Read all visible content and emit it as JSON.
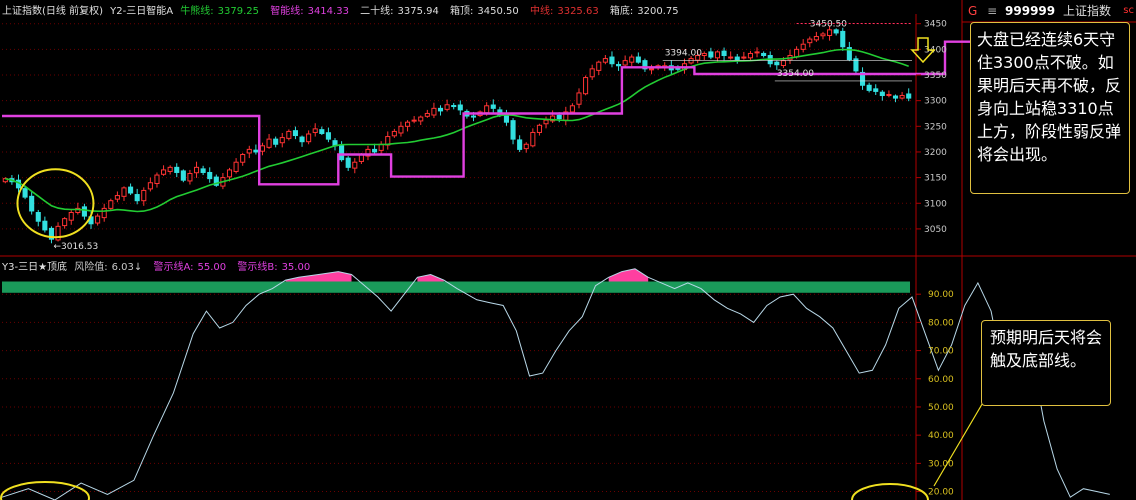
{
  "header_top": {
    "name": "上证指数(日线 前复权)",
    "indicator": "Y2-三日智能A",
    "items": [
      {
        "label": "牛熊线:",
        "value": "3379.25",
        "color": "#22cc33"
      },
      {
        "label": "智能线:",
        "value": "3414.33",
        "color": "#e040e0"
      },
      {
        "label": "二十线:",
        "value": "3375.94",
        "color": "#dddddd"
      },
      {
        "label": "箱顶:",
        "value": "3450.50",
        "color": "#dddddd"
      },
      {
        "label": "中线:",
        "value": "3325.63",
        "color": "#e03030"
      },
      {
        "label": "箱底:",
        "value": "3200.75",
        "color": "#dddddd"
      }
    ]
  },
  "header_bottom": {
    "name": "Y3-三日★顶底",
    "items": [
      {
        "label": "风险值:",
        "value": "6.03↓",
        "color": "#c8c8c8"
      },
      {
        "label": "警示线A:",
        "value": "55.00",
        "color": "#e040e0"
      },
      {
        "label": "警示线B:",
        "value": "35.00",
        "color": "#e040e0"
      }
    ]
  },
  "side": {
    "code_prefix": "G",
    "code": "999999",
    "name": "上证指数",
    "corner": "sc"
  },
  "callouts": {
    "top": "大盘已经连续6天守住3300点不破。如果明后天再不破，反身向上站稳3310点上方，阶段性弱反弹将会出现。",
    "bottom": "预期明后天将会触及底部线。"
  },
  "chart_data": [
    {
      "type": "candlestick",
      "title": "",
      "y_ticks": [
        "3450",
        "3400",
        "3350",
        "3300",
        "3250",
        "3200",
        "3150",
        "3100",
        "3050"
      ],
      "ylim": [
        3005,
        3465
      ],
      "annotations": {
        "low_label": "←3016.53",
        "box_top": "3450.50",
        "level_3394": "3394.00",
        "level_3354": "3354.00"
      },
      "closes": [
        3148,
        3142,
        3130,
        3112,
        3085,
        3065,
        3048,
        3030,
        3055,
        3070,
        3082,
        3090,
        3075,
        3060,
        3075,
        3090,
        3105,
        3115,
        3130,
        3120,
        3105,
        3125,
        3140,
        3155,
        3165,
        3170,
        3160,
        3145,
        3158,
        3170,
        3160,
        3148,
        3135,
        3150,
        3165,
        3180,
        3195,
        3205,
        3200,
        3212,
        3225,
        3215,
        3228,
        3240,
        3232,
        3220,
        3235,
        3245,
        3236,
        3225,
        3212,
        3185,
        3170,
        3180,
        3195,
        3205,
        3200,
        3215,
        3230,
        3240,
        3250,
        3258,
        3262,
        3268,
        3275,
        3285,
        3280,
        3292,
        3290,
        3282,
        3270,
        3268,
        3278,
        3290,
        3285,
        3272,
        3258,
        3225,
        3205,
        3215,
        3238,
        3252,
        3262,
        3270,
        3265,
        3278,
        3290,
        3315,
        3345,
        3362,
        3375,
        3382,
        3372,
        3368,
        3378,
        3385,
        3375,
        3362,
        3362,
        3368,
        3368,
        3360,
        3362,
        3372,
        3382,
        3388,
        3392,
        3385,
        3395,
        3388,
        3385,
        3380,
        3385,
        3392,
        3395,
        3388,
        3372,
        3370,
        3378,
        3388,
        3400,
        3410,
        3420,
        3425,
        3430,
        3438,
        3432,
        3405,
        3380,
        3358,
        3330,
        3320,
        3318,
        3310,
        3312,
        3305,
        3310,
        3305
      ],
      "series": [
        {
          "name": "牛熊线",
          "color": "#22cc33"
        },
        {
          "name": "智能线",
          "color": "#e040e0"
        }
      ],
      "smart_line": [
        [
          0,
          3270
        ],
        [
          39,
          3270
        ],
        [
          39,
          3137
        ],
        [
          51,
          3137
        ],
        [
          51,
          3195
        ],
        [
          59,
          3195
        ],
        [
          59,
          3152
        ],
        [
          70,
          3152
        ],
        [
          70,
          3275
        ],
        [
          94,
          3275
        ],
        [
          94,
          3365
        ],
        [
          105,
          3365
        ],
        [
          105,
          3352
        ],
        [
          143,
          3352
        ],
        [
          143,
          3415
        ],
        [
          168,
          3415
        ]
      ]
    },
    {
      "type": "line",
      "title": "",
      "y_ticks": [
        "90.00",
        "80.00",
        "70.00",
        "60.00",
        "50.00",
        "40.00",
        "30.00",
        "20.00"
      ],
      "ylim": [
        17,
        100
      ],
      "band": {
        "low": 90.5,
        "high": 94.5,
        "color": "#1a9a5a"
      },
      "alert_color": "#ff3fa0",
      "series": [
        {
          "name": "风险值",
          "color": "#b8d8e8",
          "values": [
            [
              0,
              18
            ],
            [
              4,
              21
            ],
            [
              8,
              17
            ],
            [
              12,
              23
            ],
            [
              16,
              19
            ],
            [
              20,
              24
            ],
            [
              23,
              40
            ],
            [
              26,
              55
            ],
            [
              29,
              76
            ],
            [
              31,
              84
            ],
            [
              33,
              78
            ],
            [
              35,
              80
            ],
            [
              37,
              86
            ],
            [
              39,
              90
            ],
            [
              41,
              92
            ],
            [
              43,
              95
            ],
            [
              45,
              96
            ],
            [
              48,
              97
            ],
            [
              51,
              98
            ],
            [
              53,
              97
            ],
            [
              55,
              93
            ],
            [
              57,
              89
            ],
            [
              59,
              84
            ],
            [
              61,
              90
            ],
            [
              63,
              96
            ],
            [
              65,
              97
            ],
            [
              67,
              95
            ],
            [
              69,
              92
            ],
            [
              72,
              88
            ],
            [
              74,
              87
            ],
            [
              76,
              86
            ],
            [
              78,
              77
            ],
            [
              80,
              61
            ],
            [
              82,
              62
            ],
            [
              84,
              70
            ],
            [
              86,
              77
            ],
            [
              88,
              82
            ],
            [
              90,
              93
            ],
            [
              92,
              96
            ],
            [
              94,
              98
            ],
            [
              96,
              99
            ],
            [
              98,
              96
            ],
            [
              100,
              94
            ],
            [
              102,
              92
            ],
            [
              104,
              94
            ],
            [
              106,
              92
            ],
            [
              108,
              88
            ],
            [
              110,
              85
            ],
            [
              112,
              83
            ],
            [
              114,
              80
            ],
            [
              116,
              86
            ],
            [
              118,
              89
            ],
            [
              120,
              90
            ],
            [
              122,
              85
            ],
            [
              124,
              82
            ],
            [
              126,
              78
            ],
            [
              128,
              70
            ],
            [
              130,
              62
            ],
            [
              132,
              63
            ],
            [
              134,
              72
            ],
            [
              136,
              85
            ],
            [
              138,
              89
            ],
            [
              140,
              76
            ],
            [
              142,
              63
            ],
            [
              144,
              72
            ],
            [
              146,
              86
            ],
            [
              148,
              94
            ],
            [
              150,
              84
            ],
            [
              152,
              60
            ],
            [
              154,
              52
            ],
            [
              156,
              70
            ],
            [
              158,
              45
            ],
            [
              160,
              28
            ],
            [
              162,
              18
            ],
            [
              164,
              21
            ],
            [
              166,
              20
            ],
            [
              168,
              19
            ]
          ]
        }
      ]
    }
  ]
}
